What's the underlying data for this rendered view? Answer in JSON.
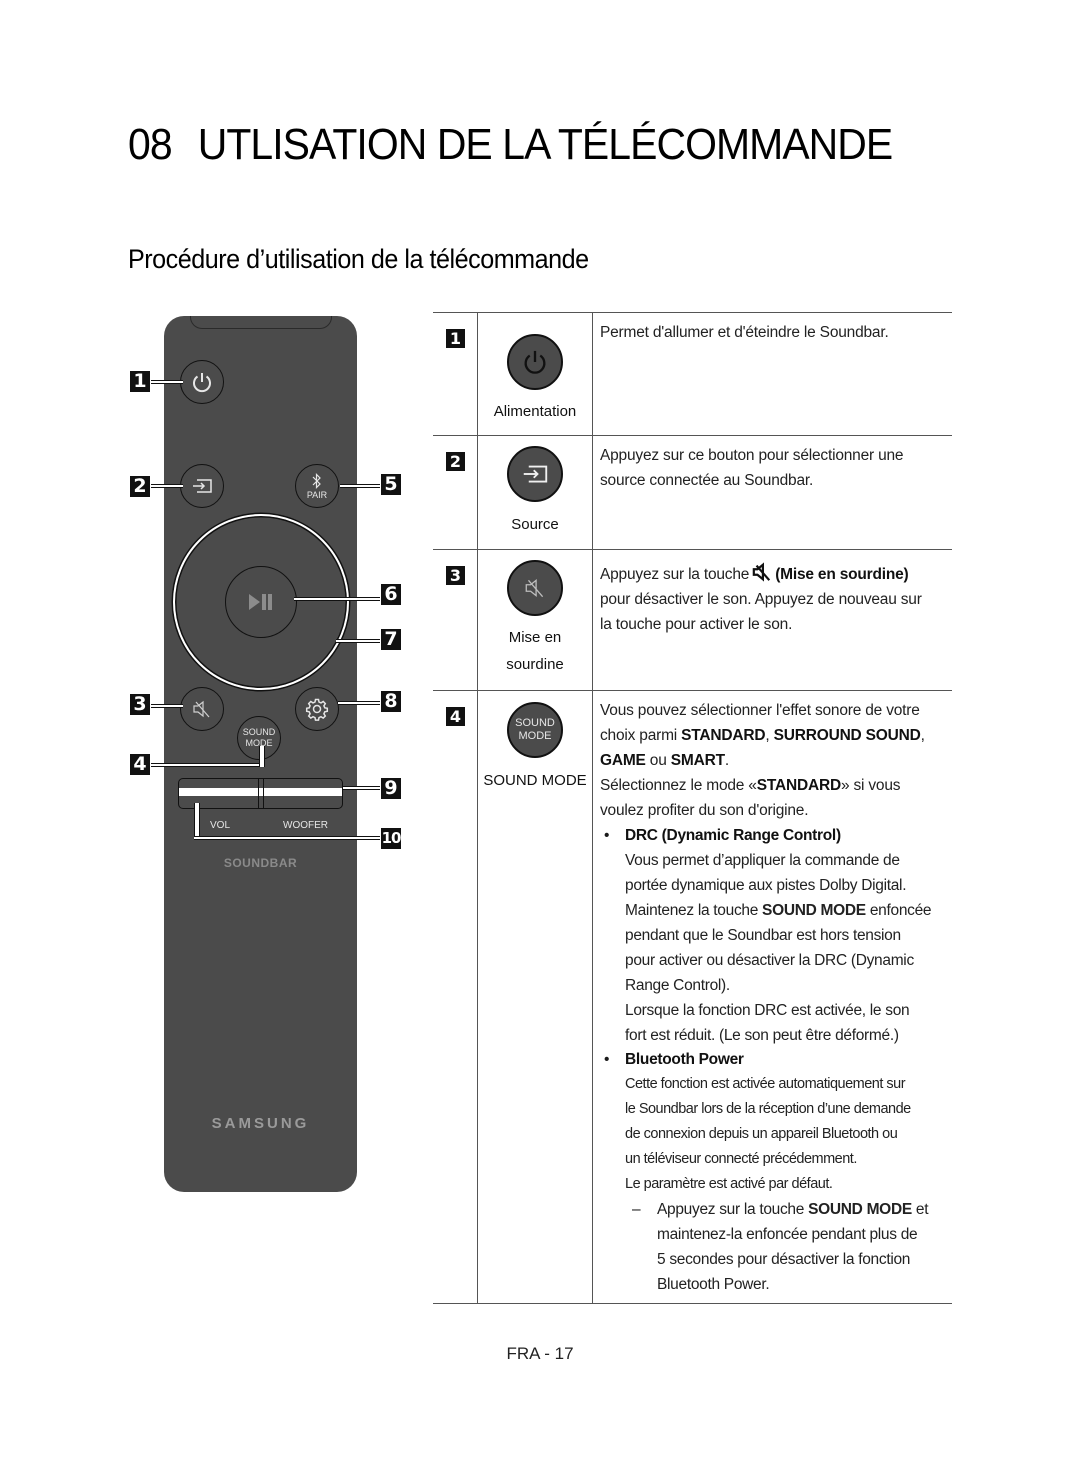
{
  "chapter": {
    "number": "08",
    "title": "UTLISATION DE LA TÉLÉCOMMANDE"
  },
  "section_title": "Procédure d’utilisation de la télécommande",
  "remote": {
    "pair_label": "PAIR",
    "sound_mode_line1": "SOUND",
    "sound_mode_line2": "MODE",
    "vol_label": "VOL",
    "woofer_label": "WOOFER",
    "soundbar_label": "SOUNDBAR",
    "brand": "SAMSUNG",
    "callouts": [
      "1",
      "2",
      "3",
      "4",
      "5",
      "6",
      "7",
      "8",
      "9",
      "10"
    ]
  },
  "table": {
    "rows": [
      {
        "number": "1",
        "icon": "power-icon",
        "label": "Alimentation",
        "description": "Permet d'allumer et d'éteindre le Soundbar."
      },
      {
        "number": "2",
        "icon": "source-icon",
        "label": "Source",
        "description_line1": "Appuyez sur ce bouton pour sélectionner une",
        "description_line2": "source connectée au Soundbar."
      },
      {
        "number": "3",
        "icon": "mute-icon",
        "label_line1": "Mise en",
        "label_line2": "sourdine",
        "description_prefix": "Appuyez sur la touche",
        "description_bold": "(Mise en sourdine)",
        "description_line2": "pour désactiver le son. Appuyez de nouveau sur",
        "description_line3": "la touche pour activer le son."
      },
      {
        "number": "4",
        "icon_line1": "SOUND",
        "icon_line2": "MODE",
        "label": "SOUND MODE",
        "intro_line1": "Vous pouvez sélectionner l'effet sonore de votre",
        "intro_line2_prefix": "choix parmi ",
        "mode_standard": "STANDARD",
        "sep_comma": ", ",
        "mode_surround": "SURROUND SOUND",
        "trail_comma": ",",
        "mode_game": "GAME",
        "word_ou": " ou ",
        "mode_smart": "SMART",
        "period": ".",
        "select_prefix": "Sélectionnez le mode «",
        "select_bold": "STANDARD",
        "select_suffix": "» si vous",
        "select_line2": "voulez profiter du son d'origine.",
        "drc": {
          "title": "DRC (Dynamic Range Control)",
          "lines": [
            "Vous permet d’appliquer la commande de",
            "portée dynamique aux pistes Dolby Digital."
          ],
          "hold_prefix": "Maintenez la touche ",
          "hold_bold": "SOUND MODE",
          "hold_suffix": " enfoncée",
          "lines2": [
            "pendant que le Soundbar est hors tension",
            "pour activer ou désactiver la DRC (Dynamic",
            "Range Control).",
            "Lorsque la fonction DRC est activée, le son",
            "fort est réduit. (Le son peut être déformé.)"
          ]
        },
        "bluetooth_power": {
          "title": "Bluetooth Power",
          "lines": [
            "Cette fonction est activée automatiquement sur",
            "le Soundbar lors de la réception d’une demande",
            "de connexion depuis un appareil Bluetooth ou",
            "un téléviseur connecté précédemment.",
            "Le paramètre est activé par défaut."
          ],
          "dash": "–",
          "dash_prefix": "Appuyez sur la touche ",
          "dash_bold": "SOUND MODE",
          "dash_suffix": " et",
          "dash_lines": [
            "maintenez-la enfoncée pendant plus de",
            "5 secondes pour désactiver la fonction",
            "Bluetooth Power."
          ]
        }
      }
    ]
  },
  "page_number": "FRA - 17"
}
